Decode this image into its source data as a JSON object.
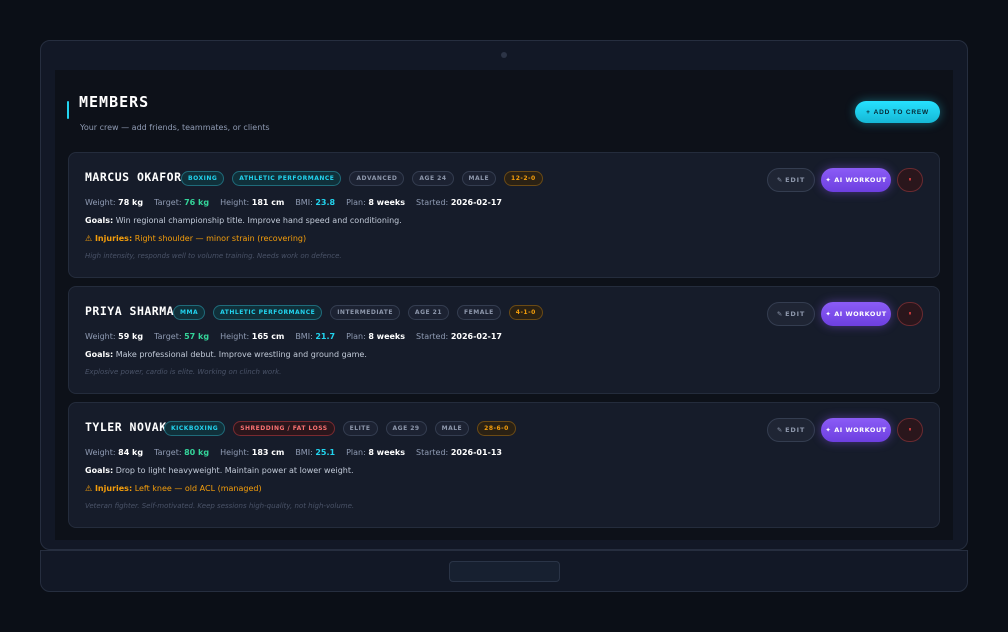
{
  "header": {
    "title": "MEMBERS",
    "subtitle": "Your crew — add friends, teammates, or clients",
    "add_button": "ADD TO CREW",
    "add_icon": "+"
  },
  "labels": {
    "weight": "Weight:",
    "target": "Target:",
    "height": "Height:",
    "bmi": "BMI:",
    "plan": "Plan:",
    "started": "Started:",
    "goals": "Goals:",
    "injuries": "⚠ Injuries:",
    "edit": "EDIT",
    "edit_icon": "✎",
    "ai_workout": "AI WORKOUT",
    "ai_icon": "✦",
    "delete_icon": "⏸"
  },
  "members": [
    {
      "name": "MARCUS OKAFOR",
      "tags": [
        {
          "text": "BOXING",
          "style": "cyan"
        },
        {
          "text": "ATHLETIC PERFORMANCE",
          "style": "cyan"
        },
        {
          "text": "ADVANCED",
          "style": "gray"
        },
        {
          "text": "AGE 24",
          "style": "gray"
        },
        {
          "text": "MALE",
          "style": "gray"
        },
        {
          "text": "12-2-0",
          "style": "orange"
        }
      ],
      "weight": "78 kg",
      "target": "76 kg",
      "height": "181 cm",
      "bmi": "23.8",
      "plan": "8 weeks",
      "started": "2026-02-17",
      "goals": "Win regional championship title. Improve hand speed and conditioning.",
      "injuries": "Right shoulder — minor strain (recovering)",
      "notes": "High intensity, responds well to volume training. Needs work on defence."
    },
    {
      "name": "PRIYA SHARMA",
      "tags": [
        {
          "text": "MMA",
          "style": "cyan"
        },
        {
          "text": "ATHLETIC PERFORMANCE",
          "style": "cyan"
        },
        {
          "text": "INTERMEDIATE",
          "style": "gray"
        },
        {
          "text": "AGE 21",
          "style": "gray"
        },
        {
          "text": "FEMALE",
          "style": "gray"
        },
        {
          "text": "4-1-0",
          "style": "orange"
        }
      ],
      "weight": "59 kg",
      "target": "57 kg",
      "height": "165 cm",
      "bmi": "21.7",
      "plan": "8 weeks",
      "started": "2026-02-17",
      "goals": "Make professional debut. Improve wrestling and ground game.",
      "injuries": "",
      "notes": "Explosive power, cardio is elite. Working on clinch work."
    },
    {
      "name": "TYLER NOVAK",
      "tags": [
        {
          "text": "KICKBOXING",
          "style": "cyan"
        },
        {
          "text": "SHREDDING / FAT LOSS",
          "style": "red"
        },
        {
          "text": "ELITE",
          "style": "gray"
        },
        {
          "text": "AGE 29",
          "style": "gray"
        },
        {
          "text": "MALE",
          "style": "gray"
        },
        {
          "text": "28-6-0",
          "style": "orange"
        }
      ],
      "weight": "84 kg",
      "target": "80 kg",
      "height": "183 cm",
      "bmi": "25.1",
      "plan": "8 weeks",
      "started": "2026-01-13",
      "goals": "Drop to light heavyweight. Maintain power at lower weight.",
      "injuries": "Left knee — old ACL (managed)",
      "notes": "Veteran fighter. Self-motivated. Keep sessions high-quality, not high-volume."
    }
  ]
}
